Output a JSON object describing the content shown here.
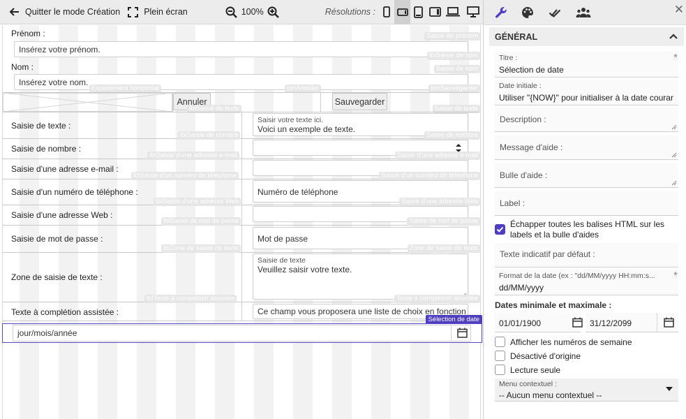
{
  "toolbar": {
    "quit_label": "Quitter le mode Création",
    "fullscreen_label": "Plein écran",
    "zoom_value": "100%",
    "resolutions_label": "Résolutions :"
  },
  "form": {
    "prenom_label": "Prénom :",
    "prenom_placeholder": "Insérez votre prénom.",
    "nom_label": "Nom :",
    "nom_placeholder": "Insérez votre nom.",
    "annuler_label": "Annuler",
    "sauvegarder_label": "Sauvegarder",
    "rows": {
      "texte": {
        "label": "Saisie de texte :",
        "hint": "Saisir votre texte ici.",
        "value": "Voici un exemple de texte."
      },
      "nombre": {
        "label": "Saisie de nombre :"
      },
      "email": {
        "label": "Saisie d'une adresse e-mail :"
      },
      "phone": {
        "label": "Saisie d'un numéro de téléphone :",
        "placeholder": "Numéro de téléphone"
      },
      "web": {
        "label": "Saisie d'une adresse Web :"
      },
      "password": {
        "label": "Saisie de mot de passe :",
        "placeholder": "Mot de passe"
      },
      "textarea": {
        "label": "Zone de saisie de texte :",
        "hint": "Saisie de texte",
        "placeholder": "Veuillez saisir votre texte."
      },
      "autocomplete": {
        "label": "Texte à complétion assistée :",
        "placeholder": "Ce champ vous proposera une liste de choix en fonction"
      }
    },
    "date_value": "jour/mois/année",
    "selected_badge": "Sélection de date"
  },
  "tags": {
    "t1": "Saisie de prénom",
    "t2": "lblSaisie de nom",
    "t3": "Saisie de nom",
    "t4": "Espacement horizontal",
    "t5": "btnAnnuler",
    "t6": "btnSauvegarder",
    "t7": "lblSaisie de texte",
    "t8": "Saisie de texte",
    "t9": "lblSaisie de nombre",
    "t10": "Saisie de nombre",
    "t11": "lblSaisie d'une adresse e-mail",
    "t12": "Saisie d'une adresse e-mail",
    "t13": "lblSaisie d'un numéro de téléphone",
    "t14": "Saisie d'un numéro de téléphone",
    "t15": "lblSaisie d'une adresse Web",
    "t16": "Saisie d'une adresse Web",
    "t17": "lblSaisie de mot de passe",
    "t18": "Saisie de mot de passe",
    "t19": "lblZone de saisie de texte",
    "t20": "Zone de saisie de texte",
    "t21": "lblTexte à complétion assistée",
    "t22": "Texte à complétion assistée"
  },
  "panel": {
    "section_title": "GÉNÉRAL",
    "titre_label": "Titre :",
    "titre_value": "Sélection de date",
    "date_init_label": "Date initiale :",
    "date_init_value": "Utiliser \"{NOW}\" pour initialiser à la date couran",
    "description_label": "Description :",
    "help_label": "Message d'aide :",
    "bubble_label": "Bulle d'aide :",
    "label_label": "Label :",
    "escape_label": "Échapper toutes les balises HTML sur les labels et la bulle d'aides",
    "placeholder_label": "Texte indicatif par défaut :",
    "format_label": "Format de la date (ex : \"dd/MM/yyyy HH:mm:s...",
    "format_value": "dd/MM/yyyy",
    "minmax_label": "Dates minimale et maximale :",
    "min_date": "01/01/1900",
    "max_date": "31/12/2099",
    "week_label": "Afficher les numéros de semaine",
    "disabled_label": "Désactivé d'origine",
    "readonly_label": "Lecture seule",
    "menu_label": "Menu contextuel :",
    "menu_value": "-- Aucun menu contextuel --"
  },
  "colors": {
    "accent": "#4e3fc0",
    "toolbar_bg": "#ececec"
  },
  "icons": [
    "arrow-left-icon",
    "fullscreen-icon",
    "zoom-out-icon",
    "zoom-in-icon",
    "phone-icon",
    "tablet-landscape-icon",
    "tablet-icon",
    "tablet-wide-icon",
    "laptop-icon",
    "desktop-icon",
    "wrench-icon",
    "palette-icon",
    "checks-icon",
    "users-icon",
    "close-icon",
    "calendar-icon"
  ]
}
